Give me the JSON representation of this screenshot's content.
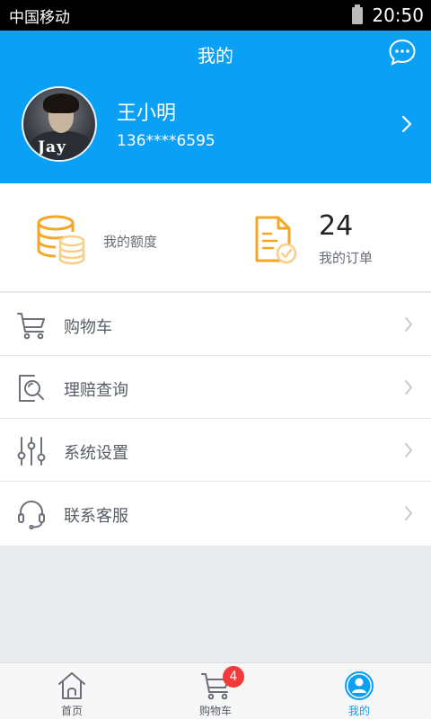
{
  "status_bar": {
    "carrier": "中国移动",
    "time": "20:50",
    "icons": [
      "battery-icon"
    ]
  },
  "header": {
    "title": "我的",
    "message_icon": "chat-bubble-icon",
    "user": {
      "name": "王小明",
      "phone": "136****6595",
      "avatar_text": "Jay"
    }
  },
  "stats": {
    "quota": {
      "label": "我的额度",
      "icon": "database-coins-icon"
    },
    "orders": {
      "count": "24",
      "label": "我的订单",
      "icon": "order-document-icon"
    }
  },
  "menu": {
    "items": [
      {
        "label": "购物车",
        "icon": "cart-icon"
      },
      {
        "label": "理赔查询",
        "icon": "claim-search-icon"
      },
      {
        "label": "系统设置",
        "icon": "settings-sliders-icon"
      },
      {
        "label": "联系客服",
        "icon": "headset-icon"
      }
    ]
  },
  "tabbar": {
    "tabs": [
      {
        "label": "首页",
        "icon": "home-icon",
        "active": false
      },
      {
        "label": "购物车",
        "icon": "cart-icon",
        "active": false,
        "badge": "4"
      },
      {
        "label": "我的",
        "icon": "user-icon",
        "active": true
      }
    ]
  },
  "colors": {
    "primary": "#0aa0f5",
    "accent_orange": "#f5a623",
    "badge_red": "#f23a3a",
    "background": "#e9ebee"
  }
}
